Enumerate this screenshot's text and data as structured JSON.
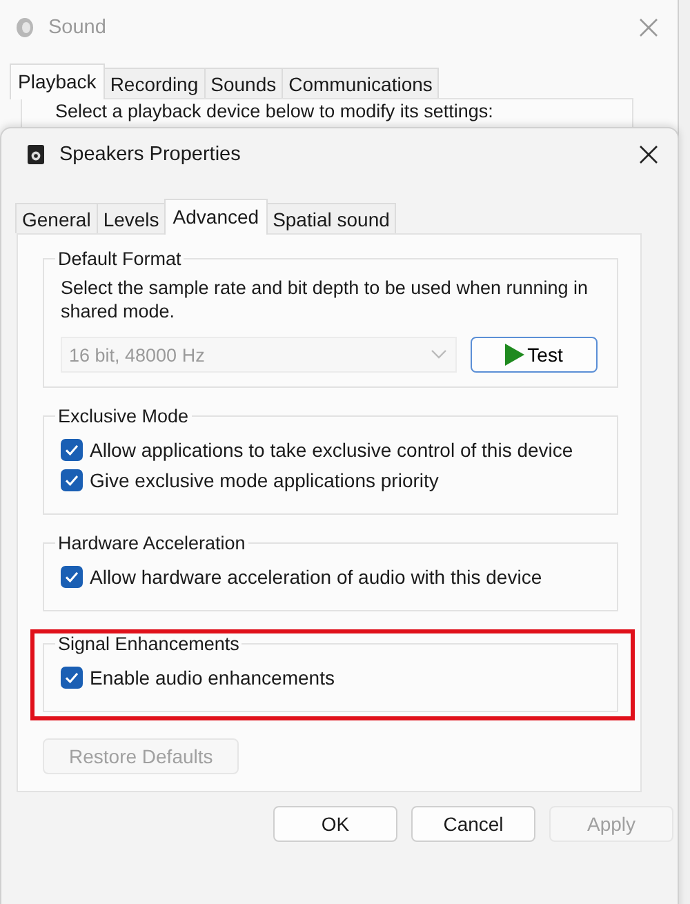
{
  "back_window": {
    "title": "Sound",
    "tabs": [
      {
        "label": "Playback",
        "selected": true
      },
      {
        "label": "Recording",
        "selected": false
      },
      {
        "label": "Sounds",
        "selected": false
      },
      {
        "label": "Communications",
        "selected": false
      }
    ],
    "instruction": "Select a playback device below to modify its settings:"
  },
  "dialog": {
    "title": "Speakers Properties",
    "tabs": [
      {
        "label": "General",
        "selected": false
      },
      {
        "label": "Levels",
        "selected": false
      },
      {
        "label": "Advanced",
        "selected": true
      },
      {
        "label": "Spatial sound",
        "selected": false
      }
    ],
    "groups": [
      {
        "kind": "format",
        "title": "Default Format",
        "highlighted": false,
        "description": "Select the sample rate and bit depth to be used when running in shared mode.",
        "format_select": {
          "value": "16 bit, 48000 Hz",
          "disabled": true
        },
        "test_button": "Test"
      },
      {
        "kind": "checks",
        "title": "Exclusive Mode",
        "highlighted": false,
        "options": [
          {
            "label": "Allow applications to take exclusive control of this device",
            "checked": true
          },
          {
            "label": "Give exclusive mode applications priority",
            "checked": true
          }
        ]
      },
      {
        "kind": "checks",
        "title": "Hardware Acceleration",
        "highlighted": false,
        "options": [
          {
            "label": "Allow hardware acceleration of audio with this device",
            "checked": true
          }
        ]
      },
      {
        "kind": "checks",
        "title": "Signal Enhancements",
        "highlighted": true,
        "options": [
          {
            "label": "Enable audio enhancements",
            "checked": true
          }
        ]
      }
    ],
    "restore_button": {
      "label": "Restore Defaults",
      "disabled": true
    },
    "buttons": [
      {
        "label": "OK",
        "disabled": false
      },
      {
        "label": "Cancel",
        "disabled": false
      },
      {
        "label": "Apply",
        "disabled": true
      }
    ]
  }
}
